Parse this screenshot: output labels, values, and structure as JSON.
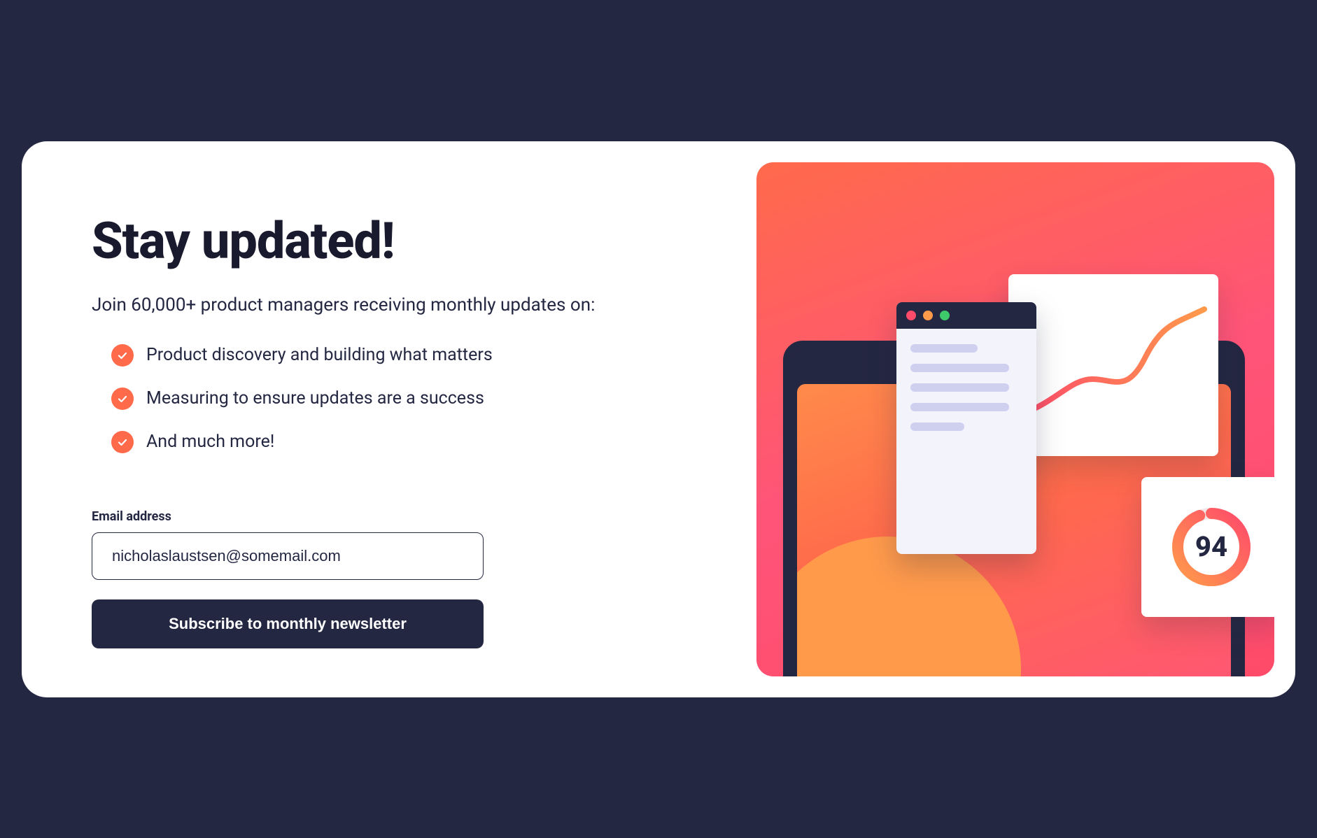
{
  "heading": "Stay updated!",
  "subtitle": "Join 60,000+ product managers receiving monthly updates on:",
  "bullets": [
    "Product discovery and building what matters",
    "Measuring to ensure updates are a success",
    "And much more!"
  ],
  "form": {
    "email_label": "Email address",
    "email_value": "nicholaslaustsen@somemail.com",
    "submit_label": "Subscribe to monthly newsletter"
  },
  "illustration": {
    "score_value": "94"
  },
  "colors": {
    "brand_dark": "#242742",
    "accent": "#ff6a4b",
    "gradient_end": "#ff4b6a"
  }
}
